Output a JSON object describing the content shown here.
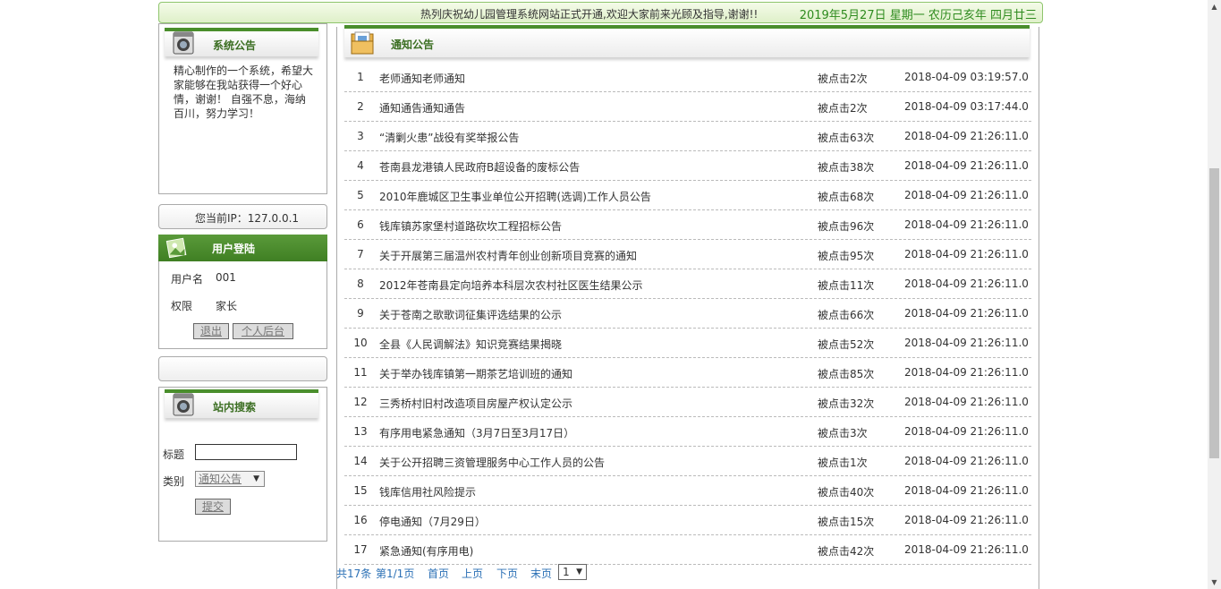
{
  "topbar": {
    "message": "热列庆祝幼儿园管理系统网站正式开通,欢迎大家前来光顾及指导,谢谢!!",
    "date": "2019年5月27日 星期一 农历己亥年 四月廿三"
  },
  "system_notice": {
    "title": "系统公告",
    "text": "精心制作的一个系统，希望大家能够在我站获得一个好心情，谢谢！ 自强不息，海纳百川，努力学习！"
  },
  "ip": {
    "text": "您当前IP：127.0.0.1"
  },
  "login": {
    "title": "用户登陆",
    "username_label": "用户名",
    "username_value": "001",
    "role_label": "权限",
    "role_value": "家长",
    "logout_button": "退出",
    "backend_button": "个人后台"
  },
  "search": {
    "title": "站内搜索",
    "title_label": "标题",
    "title_value": "",
    "category_label": "类别",
    "category_value": "通知公告",
    "submit_button": "提交"
  },
  "main": {
    "title": "通知公告",
    "rows": [
      {
        "n": "1",
        "title": "老师通知老师通知",
        "clicks": "被点击2次",
        "time": "2018-04-09 03:19:57.0"
      },
      {
        "n": "2",
        "title": "通知通告通知通告",
        "clicks": "被点击2次",
        "time": "2018-04-09 03:17:44.0"
      },
      {
        "n": "3",
        "title": "“清剿火患”战役有奖举报公告",
        "clicks": "被点击63次",
        "time": "2018-04-09 21:26:11.0"
      },
      {
        "n": "4",
        "title": "苍南县龙港镇人民政府B超设备的废标公告",
        "clicks": "被点击38次",
        "time": "2018-04-09 21:26:11.0"
      },
      {
        "n": "5",
        "title": "2010年鹿城区卫生事业单位公开招聘(选调)工作人员公告",
        "clicks": "被点击68次",
        "time": "2018-04-09 21:26:11.0"
      },
      {
        "n": "6",
        "title": "钱库镇苏家堡村道路砍坎工程招标公告",
        "clicks": "被点击96次",
        "time": "2018-04-09 21:26:11.0"
      },
      {
        "n": "7",
        "title": "关于开展第三届温州农村青年创业创新项目竞赛的通知",
        "clicks": "被点击95次",
        "time": "2018-04-09 21:26:11.0"
      },
      {
        "n": "8",
        "title": "2012年苍南县定向培养本科层次农村社区医生结果公示",
        "clicks": "被点击11次",
        "time": "2018-04-09 21:26:11.0"
      },
      {
        "n": "9",
        "title": "关于苍南之歌歌词征集评选结果的公示",
        "clicks": "被点击66次",
        "time": "2018-04-09 21:26:11.0"
      },
      {
        "n": "10",
        "title": "全县《人民调解法》知识竞赛结果揭晓",
        "clicks": "被点击52次",
        "time": "2018-04-09 21:26:11.0"
      },
      {
        "n": "11",
        "title": "关于举办钱库镇第一期茶艺培训班的通知",
        "clicks": "被点击85次",
        "time": "2018-04-09 21:26:11.0"
      },
      {
        "n": "12",
        "title": "三秀桥村旧村改造项目房屋产权认定公示",
        "clicks": "被点击32次",
        "time": "2018-04-09 21:26:11.0"
      },
      {
        "n": "13",
        "title": "有序用电紧急通知（3月7日至3月17日）",
        "clicks": "被点击3次",
        "time": "2018-04-09 21:26:11.0"
      },
      {
        "n": "14",
        "title": "关于公开招聘三资管理服务中心工作人员的公告",
        "clicks": "被点击1次",
        "time": "2018-04-09 21:26:11.0"
      },
      {
        "n": "15",
        "title": "钱库信用社风险提示",
        "clicks": "被点击40次",
        "time": "2018-04-09 21:26:11.0"
      },
      {
        "n": "16",
        "title": "停电通知（7月29日）",
        "clicks": "被点击15次",
        "time": "2018-04-09 21:26:11.0"
      },
      {
        "n": "17",
        "title": "紧急通知(有序用电)",
        "clicks": "被点击42次",
        "time": "2018-04-09 21:26:11.0"
      }
    ]
  },
  "pager": {
    "total": "共17条",
    "page": "第1/1页",
    "first": "首页",
    "prev": "上页",
    "next": "下页",
    "last": "末页",
    "select_value": "1"
  },
  "colors": {
    "accent": "#4a8e2c",
    "link": "#2a6fb5"
  }
}
